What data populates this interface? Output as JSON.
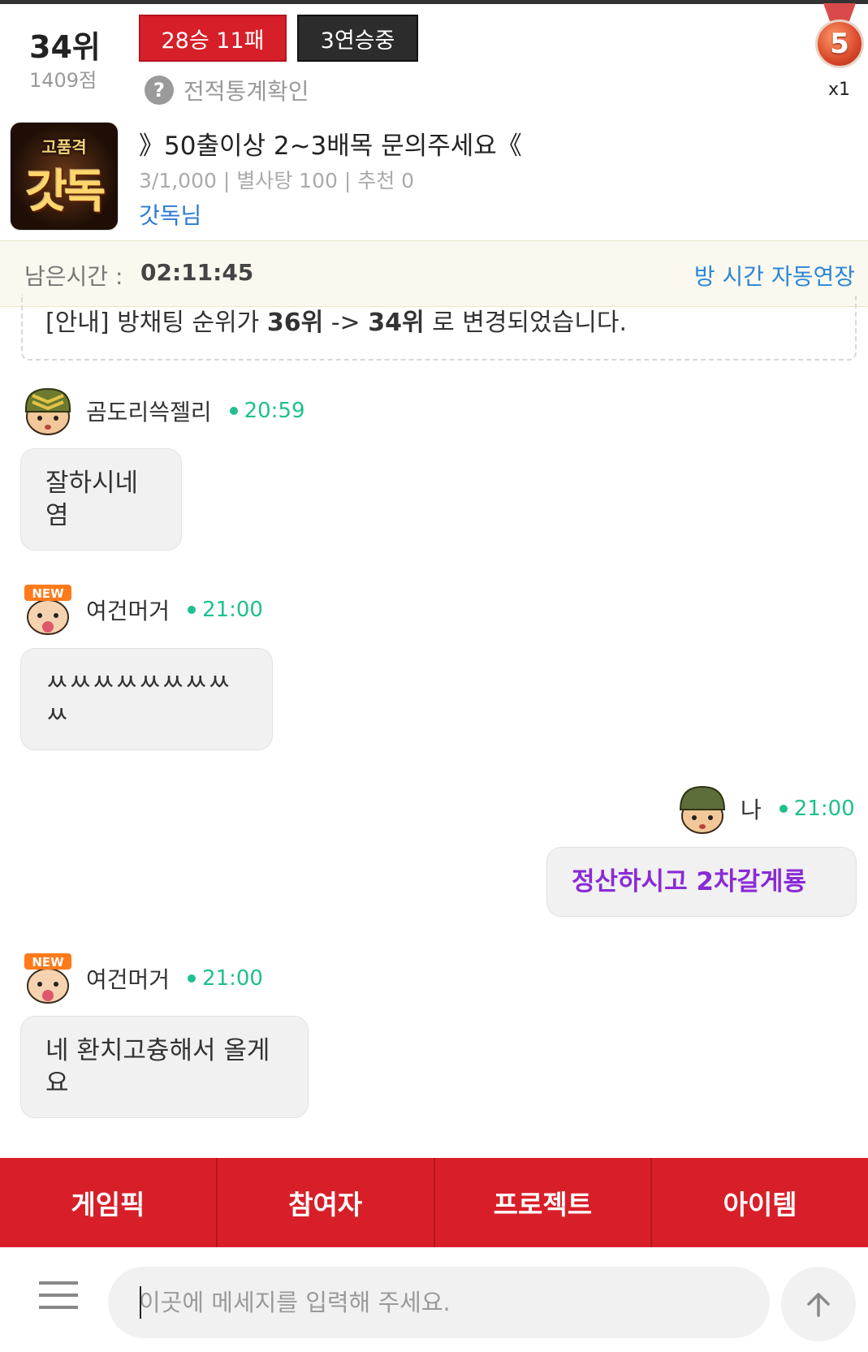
{
  "header": {
    "rank": "34위",
    "score": "1409점",
    "record": "28승 11패",
    "streak": "3연승중",
    "stats_link": "전적통계확인",
    "stats_icon": "help-circle-icon",
    "medal_level": "5",
    "medal_count": "x1"
  },
  "room": {
    "thumbnail_text_top": "고품격",
    "thumbnail_text_main": "갓독",
    "title": "》50출이상 2~3배목 문의주세요《",
    "meta": "3/1,000 | 별사탕 100 | 추천 0",
    "owner": "갓독님"
  },
  "timer": {
    "label": "남은시간 :",
    "value": "02:11:45",
    "extend_label": "방 시간 자동연장"
  },
  "notice": {
    "prefix": "[안내] 방채팅 순위가 ",
    "from_rank": "36위",
    "arrow": " -> ",
    "to_rank": "34위",
    "suffix": " 로 변경되었습니다."
  },
  "messages": [
    {
      "nick": "곰도리쓱젤리",
      "time": "20:59",
      "text_line1": "잘하시네",
      "text_line2": "염",
      "avatar": "sergeant-avatar-icon",
      "mine": false
    },
    {
      "nick": "여건머거",
      "time": "21:00",
      "text_line1": "ㅆㅆㅆㅆㅆㅆㅆㅆ",
      "text_line2": "ㅆ",
      "avatar": "new-user-avatar-icon",
      "mine": false
    },
    {
      "nick": "나",
      "time": "21:00",
      "text_line1": "정산하시고 2차갈게룡",
      "avatar": "soldier-avatar-icon",
      "mine": true
    },
    {
      "nick": "여건머거",
      "time": "21:00",
      "text_line1": "네 환치고츙해서 올게",
      "text_line2": "요",
      "avatar": "new-user-avatar-icon",
      "mine": false
    }
  ],
  "tabs": [
    "게임픽",
    "참여자",
    "프로젝트",
    "아이템"
  ],
  "input": {
    "placeholder": "이곳에 메세지를 입력해 주세요.",
    "menu_icon": "hamburger-menu-icon",
    "send_icon": "arrow-up-icon"
  },
  "colors": {
    "accent_red": "#d81f29",
    "online_green": "#1fbf8f",
    "link_blue": "#2b86d6",
    "my_message_purple": "#8a2bd6"
  }
}
